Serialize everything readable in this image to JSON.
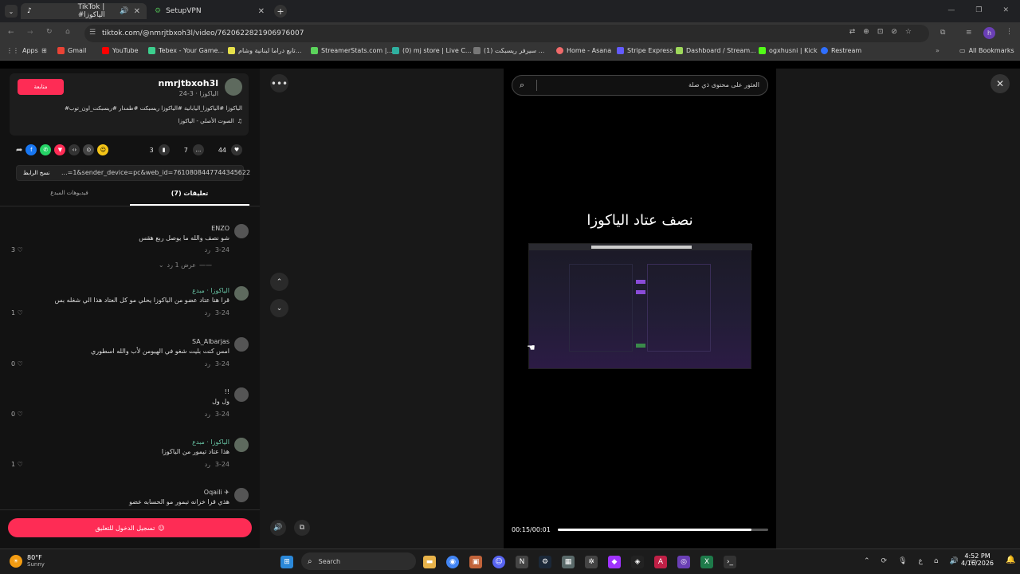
{
  "browser": {
    "tabs": [
      {
        "title": "TikTok | #الياكوزا",
        "active": true
      },
      {
        "title": "SetupVPN",
        "active": false
      }
    ],
    "url": "tiktok.com/@nmrjtbxoh3l/video/7620622821906976007",
    "bookmarks": [
      "Apps",
      "Gmail",
      "YouTube",
      "Tebex - Your Game...",
      "تابع دراما لبنانية وشام...",
      "StreamerStats.com |...",
      "(0) mj store | Live C...",
      "(1) سيرفر ريسبكت ...",
      "Home - Asana",
      "Stripe Express",
      "Dashboard / Stream...",
      "ogxhusni | Kick",
      "Restream",
      "All Bookmarks"
    ]
  },
  "post": {
    "follow_label": "متابعة",
    "username": "nmrjtbxoh3l",
    "subline": "الياكوزا · 3-24",
    "caption": "#الياكوزا #الياكوزا_اليابانية #الياكوزا ريسبكت #طمدار #ريسبكت_اون_توب",
    "sound": "الصوت الأصلي - الياكوزا",
    "likes": "44",
    "comments": "7",
    "saves": "3",
    "link": "...=1&sender_device=pc&web_id=7610808447744345622",
    "copy_link_label": "نسخ الرابط",
    "tab_comments": "تعليقات (7)",
    "tab_creator": "فيديوهات المبدع"
  },
  "comments": [
    {
      "user": "ENZO",
      "text": "شو نصف والله ما يوصل ربع هقس",
      "date": "3-24",
      "reply": "رد",
      "likes": "3",
      "more": "عرض 1 رد"
    },
    {
      "user": "الياكوزا · مبدع",
      "text": "قرا هنا عتاد عضو من الياكوزا يحلي مو كل العتاد هذا الي شغله بس",
      "date": "3-24",
      "reply": "رد",
      "likes": "1"
    },
    {
      "user": "SA_Albarjas",
      "text": "امس كنت بليت شغو في الهيومن لأب والله اسطوري",
      "date": "3-24",
      "reply": "رد",
      "likes": "0"
    },
    {
      "user": "!!",
      "text": "ول ول",
      "date": "3-24",
      "reply": "رد",
      "likes": "0"
    },
    {
      "user": "الياكوزا · مبدع",
      "text": "هذا عتاد تيمور من الياكوزا",
      "date": "3-24",
      "reply": "رد",
      "likes": "1"
    },
    {
      "user": "Oqaili ✈",
      "text": "هذي قرا خزانه تيمور مو الحسابه عضو",
      "date": "",
      "reply": "",
      "likes": ""
    }
  ],
  "login_button": "تسجيل الدخول للتعليق",
  "video": {
    "search_placeholder": "العثور على محتوى ذي صلة",
    "title": "نصف عتاد الياكوزا",
    "time": "00:15/00:01",
    "progress": 0.92
  },
  "taskbar": {
    "temp": "80°F",
    "weather": "Sunny",
    "search": "Search",
    "time": "4:52 PM",
    "date": "4/16/2026",
    "lang": "ع"
  }
}
